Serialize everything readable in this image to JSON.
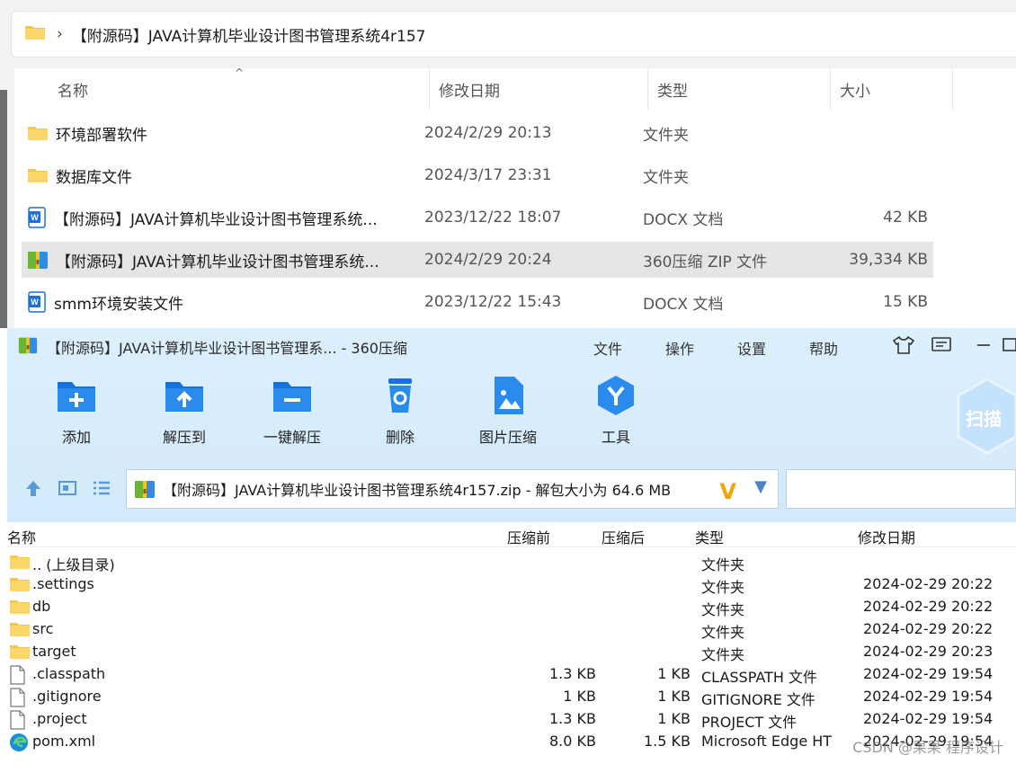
{
  "explorer": {
    "address_path": "【附源码】JAVA计算机毕业设计图书管理系统4r157",
    "columns": {
      "name": "名称",
      "date": "修改日期",
      "type": "类型",
      "size": "大小"
    },
    "rows": [
      {
        "name": "环境部署软件",
        "date": "2024/2/29 20:13",
        "type": "文件夹",
        "size": "",
        "icon": "folder-icon"
      },
      {
        "name": "数据库文件",
        "date": "2024/3/17 23:31",
        "type": "文件夹",
        "size": "",
        "icon": "folder-icon"
      },
      {
        "name": "【附源码】JAVA计算机毕业设计图书管理系统...",
        "date": "2023/12/22 18:07",
        "type": "DOCX 文档",
        "size": "42 KB",
        "icon": "docx-icon"
      },
      {
        "name": "【附源码】JAVA计算机毕业设计图书管理系统...",
        "date": "2024/2/29 20:24",
        "type": "360压缩 ZIP 文件",
        "size": "39,334 KB",
        "icon": "zip-icon",
        "selected": true
      },
      {
        "name": "smm环境安装文件",
        "date": "2023/12/22 15:43",
        "type": "DOCX 文档",
        "size": "15 KB",
        "icon": "docx-icon"
      }
    ]
  },
  "zip": {
    "title": "【附源码】JAVA计算机毕业设计图书管理系... - 360压缩",
    "menu": {
      "file": "文件",
      "ops": "操作",
      "settings": "设置",
      "help": "帮助"
    },
    "toolbar": {
      "add": "添加",
      "extract_to": "解压到",
      "one_click": "一键解压",
      "delete": "删除",
      "image_compress": "图片压缩",
      "tools": "工具"
    },
    "scan_label": "扫描",
    "path_text": "【附源码】JAVA计算机毕业设计图书管理系统4r157.zip - 解包大小为 64.6 MB",
    "columns": {
      "name": "名称",
      "before": "压缩前",
      "after": "压缩后",
      "type": "类型",
      "date": "修改日期"
    },
    "rows": [
      {
        "name": ".. (上级目录)",
        "before": "",
        "after": "",
        "type": "文件夹",
        "date": "",
        "icon": "folder-icon"
      },
      {
        "name": ".settings",
        "before": "",
        "after": "",
        "type": "文件夹",
        "date": "2024-02-29 20:22",
        "icon": "folder-icon"
      },
      {
        "name": "db",
        "before": "",
        "after": "",
        "type": "文件夹",
        "date": "2024-02-29 20:22",
        "icon": "folder-icon"
      },
      {
        "name": "src",
        "before": "",
        "after": "",
        "type": "文件夹",
        "date": "2024-02-29 20:22",
        "icon": "folder-icon"
      },
      {
        "name": "target",
        "before": "",
        "after": "",
        "type": "文件夹",
        "date": "2024-02-29 20:23",
        "icon": "folder-icon"
      },
      {
        "name": ".classpath",
        "before": "1.3 KB",
        "after": "1 KB",
        "type": "CLASSPATH 文件",
        "date": "2024-02-29 19:54",
        "icon": "file-icon"
      },
      {
        "name": ".gitignore",
        "before": "1 KB",
        "after": "1 KB",
        "type": "GITIGNORE 文件",
        "date": "2024-02-29 19:54",
        "icon": "file-icon"
      },
      {
        "name": ".project",
        "before": "1.3 KB",
        "after": "1 KB",
        "type": "PROJECT 文件",
        "date": "2024-02-29 19:54",
        "icon": "file-icon"
      },
      {
        "name": "pom.xml",
        "before": "8.0 KB",
        "after": "1.5 KB",
        "type": "Microsoft Edge HT",
        "date": "2024-02-29 19:54",
        "icon": "edge-icon"
      }
    ]
  },
  "watermark": "CSDN @果果 程序设计",
  "colors": {
    "folder": "#f7c548",
    "accent_blue": "#1e88e5",
    "zip_bg": "#d3eafc",
    "selected_row": "#e5e5e5"
  }
}
